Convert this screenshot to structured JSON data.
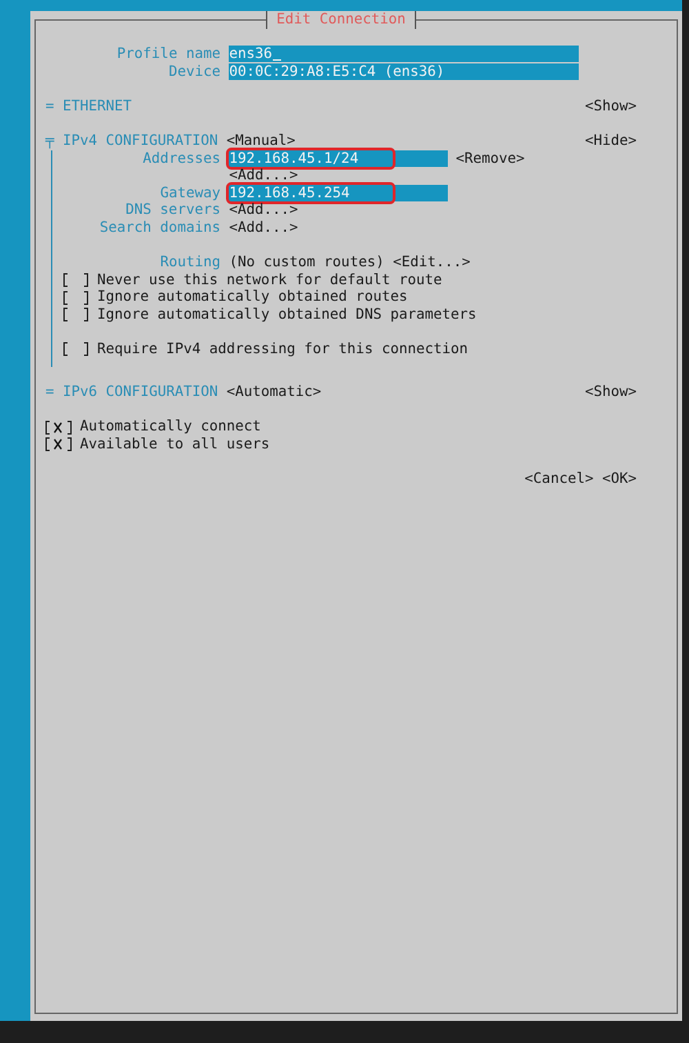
{
  "dialog": {
    "title": "Edit Connection"
  },
  "profile": {
    "label": "Profile name",
    "value": "ens36",
    "focused": true
  },
  "device": {
    "label": "Device",
    "value": "00:0C:29:A8:E5:C4 (ens36)"
  },
  "ethernet": {
    "marker": "=",
    "title": "ETHERNET",
    "toggle": "<Show>"
  },
  "ipv4": {
    "marker": "╤",
    "title": "IPv4 CONFIGURATION",
    "mode": "<Manual>",
    "toggle": "<Hide>",
    "addresses": {
      "label": "Addresses",
      "items": [
        {
          "value": "192.168.45.1/24",
          "remove": "<Remove>",
          "highlighted": true
        }
      ],
      "add": "<Add...>"
    },
    "gateway": {
      "label": "Gateway",
      "value": "192.168.45.254",
      "highlighted": true
    },
    "dns_servers": {
      "label": "DNS servers",
      "add": "<Add...>"
    },
    "search_domains": {
      "label": "Search domains",
      "add": "<Add...>"
    },
    "routing": {
      "label": "Routing",
      "value": "(No custom routes)",
      "button": "<Edit...>"
    },
    "options": [
      {
        "label": "Never use this network for default route",
        "checked": false
      },
      {
        "label": "Ignore automatically obtained routes",
        "checked": false
      },
      {
        "label": "Ignore automatically obtained DNS parameters",
        "checked": false
      }
    ],
    "require": {
      "label": "Require IPv4 addressing for this connection",
      "checked": false
    }
  },
  "ipv6": {
    "marker": "=",
    "title": "IPv6 CONFIGURATION",
    "mode": "<Automatic>",
    "toggle": "<Show>"
  },
  "options": [
    {
      "label": "Automatically connect",
      "checked": true
    },
    {
      "label": "Available to all users",
      "checked": true
    }
  ],
  "buttons": [
    "<Cancel>",
    "<OK>"
  ]
}
